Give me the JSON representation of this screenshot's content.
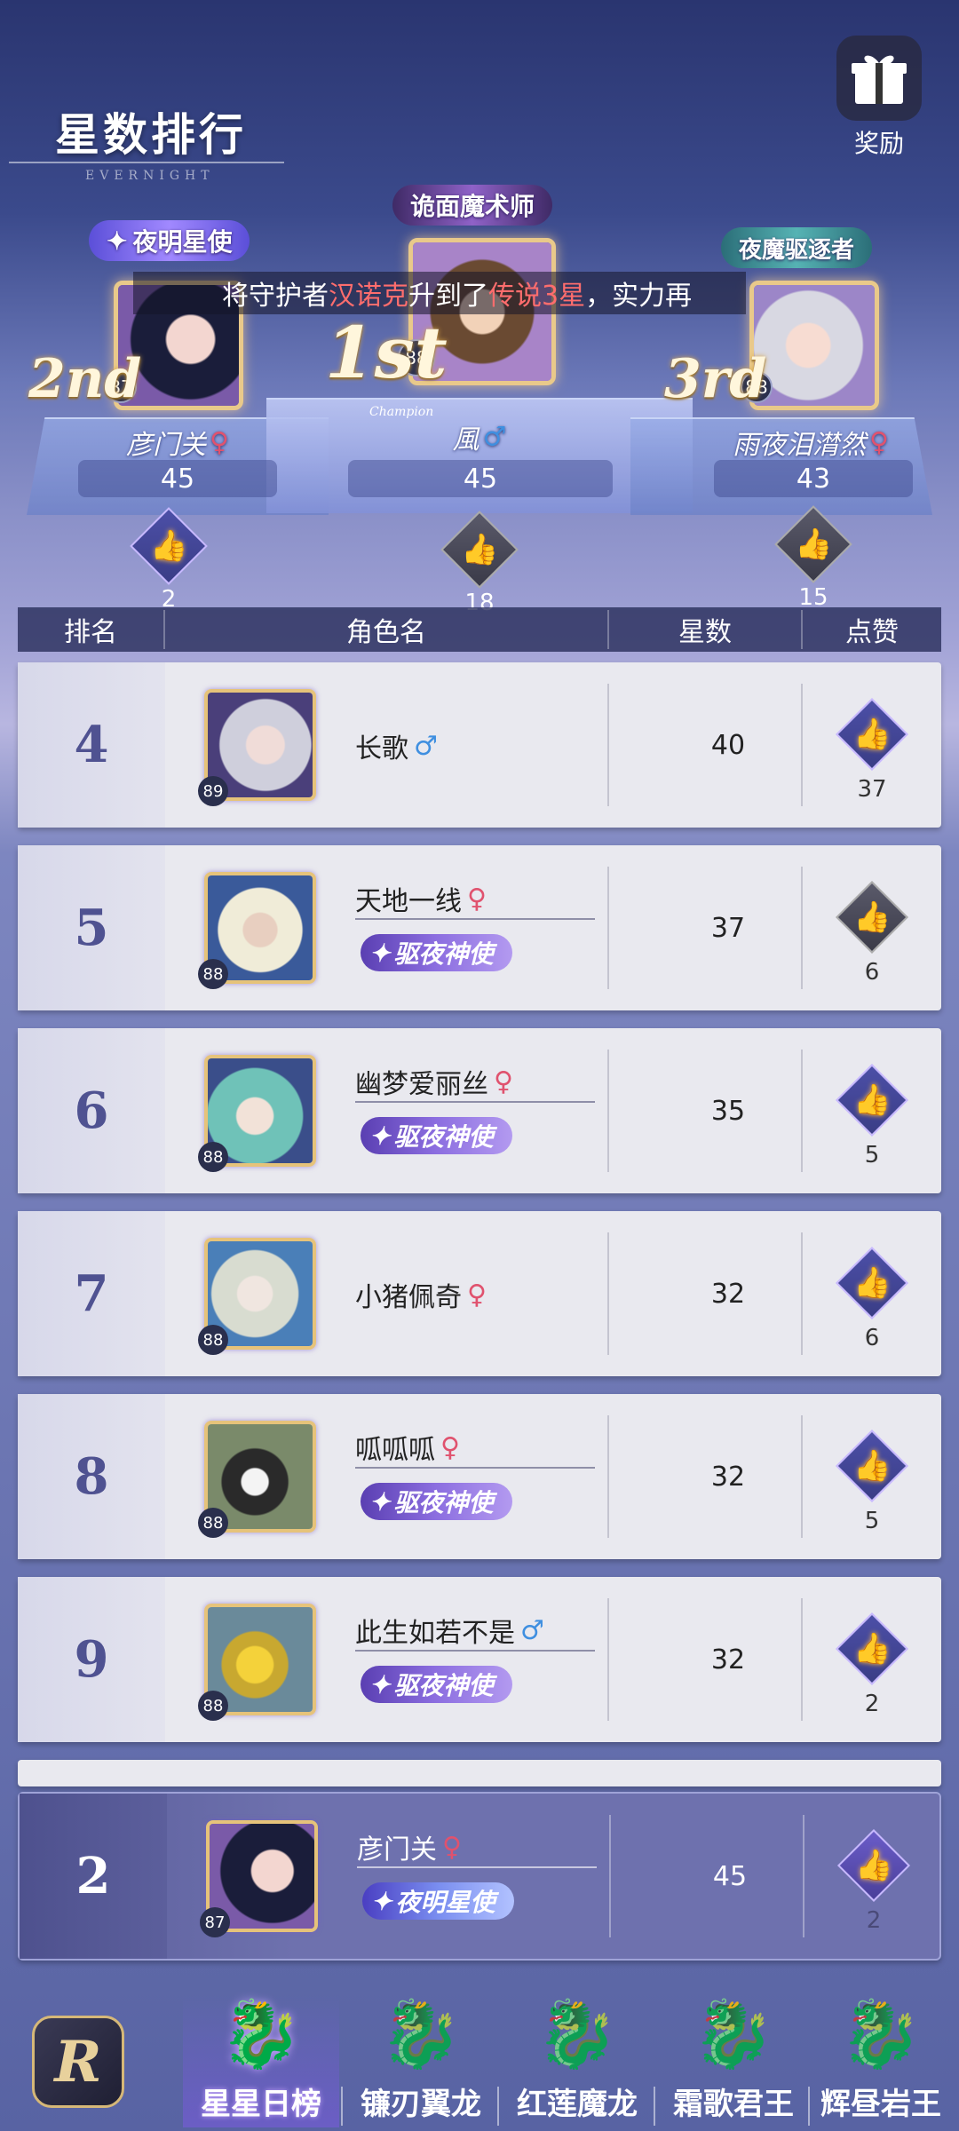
{
  "header": {
    "title": "星数排行",
    "subtitle": "EVERNIGHT",
    "reward_label": "奖励"
  },
  "marquee": {
    "prefix": "将守护者",
    "hero": "汉诺克",
    "middle": "升到了",
    "grade": "传说3星",
    "suffix": "，实力再"
  },
  "podium": {
    "first": {
      "rank_label": "1st",
      "banner": "诡面魔术师",
      "level": "88",
      "name": "風",
      "gender": "♂",
      "stars": "45",
      "likes": "18",
      "sub_label": "Champion"
    },
    "second": {
      "rank_label": "2nd",
      "banner": "夜明星使",
      "level": "87",
      "name": "彦门关",
      "gender": "♀",
      "stars": "45",
      "likes": "2"
    },
    "third": {
      "rank_label": "3rd",
      "banner": "夜魔驱逐者",
      "level": "88",
      "name": "雨夜泪潸然",
      "gender": "♀",
      "stars": "43",
      "likes": "15"
    }
  },
  "table": {
    "headers": [
      "排名",
      "角色名",
      "星数",
      "点赞"
    ]
  },
  "rows": [
    {
      "rank": "4",
      "name": "长歌",
      "gender": "♂",
      "level": "89",
      "stars": "40",
      "likes": "37",
      "badge": ""
    },
    {
      "rank": "5",
      "name": "天地一线",
      "gender": "♀",
      "level": "88",
      "stars": "37",
      "likes": "6",
      "badge": "驱夜神使"
    },
    {
      "rank": "6",
      "name": "幽梦爱丽丝",
      "gender": "♀",
      "level": "88",
      "stars": "35",
      "likes": "5",
      "badge": "驱夜神使"
    },
    {
      "rank": "7",
      "name": "小猪佩奇",
      "gender": "♀",
      "level": "88",
      "stars": "32",
      "likes": "6",
      "badge": ""
    },
    {
      "rank": "8",
      "name": "呱呱呱",
      "gender": "♀",
      "level": "88",
      "stars": "32",
      "likes": "5",
      "badge": "驱夜神使"
    },
    {
      "rank": "9",
      "name": "此生如若不是",
      "gender": "♂",
      "level": "88",
      "stars": "32",
      "likes": "2",
      "badge": "驱夜神使"
    }
  ],
  "my_row": {
    "rank": "2",
    "name": "彦门关",
    "gender": "♀",
    "level": "87",
    "stars": "45",
    "likes": "2",
    "badge": "夜明星使"
  },
  "tabs": [
    {
      "label": "星星日榜",
      "active": true
    },
    {
      "label": "镰刃翼龙",
      "active": false
    },
    {
      "label": "红莲魔龙",
      "active": false
    },
    {
      "label": "霜歌君王",
      "active": false
    },
    {
      "label": "辉昼岩王",
      "active": false
    }
  ],
  "icons": {
    "star": "✦",
    "thumb": "👍",
    "dragon": "🐉",
    "gift": "🎁"
  },
  "colors": {
    "accent_gold": "#e6c37a",
    "accent_purple": "#8c6ee0",
    "highlight_red": "#ff6d6d"
  }
}
